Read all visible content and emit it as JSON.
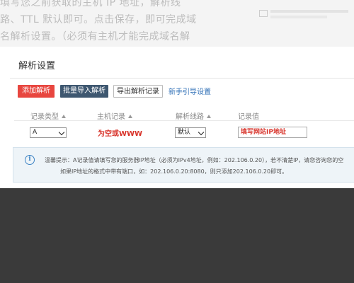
{
  "article": {
    "lines": [
      "填写您之前获取的主机 IP 地址，解析线",
      "路、TTL 默认即可。点击保存，即可完成域",
      "名解析设置。（必须有主机才能完成域名解"
    ]
  },
  "panel": {
    "title": "解析设置",
    "buttons": {
      "add": "添加解析",
      "import": "批量导入解析",
      "export": "导出解析记录"
    },
    "guide_link": "新手引导设置",
    "columns": [
      "记录类型",
      "主机记录",
      "解析线路",
      "记录值"
    ],
    "row": {
      "record_type": "A",
      "host_hint": "为空或WWW",
      "line": "默认",
      "value_hint": "填写网站IP地址"
    },
    "tip": {
      "line1": "温馨提示：A记录值请填写您的服务器IP地址（必须为IPv4地址，例如：202.106.0.20），若不清楚IP，请您咨询您的空",
      "line2": "如果IP地址的格式中带有端口，如：202.106.0.20:8080，则只添加202.106.0.20即可。"
    }
  },
  "colors": {
    "add_button": "#e8463f",
    "import_button": "#3e5770",
    "link": "#2f6fb6",
    "hint_red": "#d8342b",
    "tip_bg": "#eef4f8",
    "page_bg": "#3a3a3a"
  }
}
